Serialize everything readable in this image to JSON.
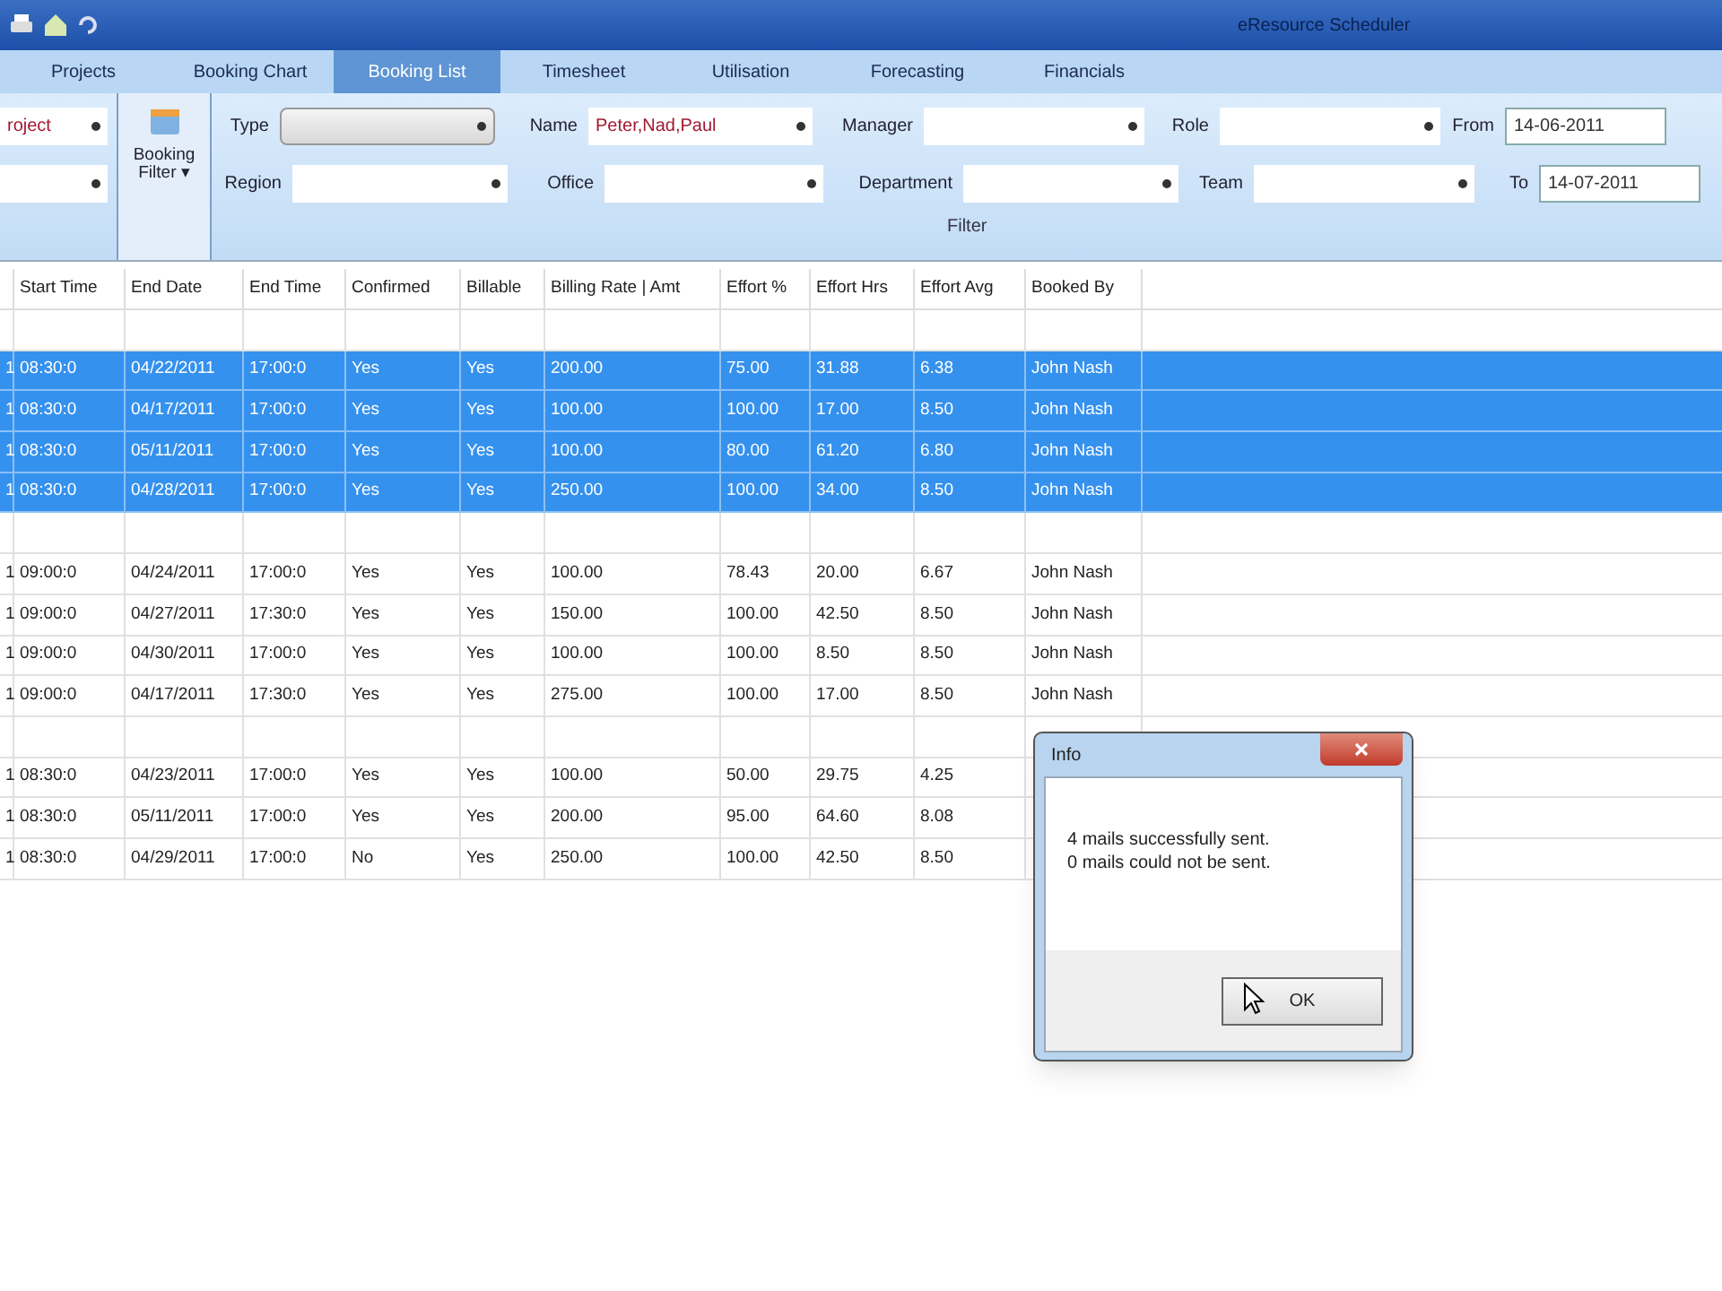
{
  "window": {
    "title": "eResource Scheduler"
  },
  "tabs": [
    {
      "label": "Projects",
      "selected": false
    },
    {
      "label": "Booking Chart",
      "selected": false
    },
    {
      "label": "Booking List",
      "selected": true
    },
    {
      "label": "Timesheet",
      "selected": false
    },
    {
      "label": "Utilisation",
      "selected": false
    },
    {
      "label": "Forecasting",
      "selected": false
    },
    {
      "label": "Financials",
      "selected": false
    }
  ],
  "left_group": {
    "field": {
      "value": "roject"
    }
  },
  "booking_filter_button": {
    "label": "Booking Filter ▾"
  },
  "filter": {
    "group_label": "Filter",
    "rows": [
      [
        {
          "label": "Type",
          "focused": true
        },
        {
          "label": "Name",
          "value": "Peter,Nad,Paul",
          "focused": false
        },
        {
          "label": "Manager",
          "focused": false
        },
        {
          "label": "Role",
          "focused": false
        },
        {
          "label": "From",
          "value": "14-06-2011",
          "kind": "date"
        }
      ],
      [
        {
          "label": "Region",
          "focused": false
        },
        {
          "label": "Office",
          "focused": false
        },
        {
          "label": "Department",
          "focused": false
        },
        {
          "label": "Team",
          "focused": false
        },
        {
          "label": "To",
          "value": "14-07-2011",
          "kind": "date"
        }
      ]
    ]
  },
  "table": {
    "columns": [
      null,
      "Start Time",
      "End Date",
      "End Time",
      "Confirmed",
      "Billable",
      "Billing Rate | Amt",
      "Effort %",
      "Effort Hrs",
      "Effort Avg",
      "Booked By"
    ],
    "rows": [
      {
        "kind": "group",
        "selected": false
      },
      {
        "kind": "data",
        "selected": true,
        "cells": [
          "1",
          "08:30:0",
          "04/22/2011",
          "17:00:0",
          "Yes",
          "Yes",
          "200.00",
          "75.00",
          "31.88",
          "6.38",
          "John Nash"
        ]
      },
      {
        "kind": "data",
        "selected": true,
        "cells": [
          "1",
          "08:30:0",
          "04/17/2011",
          "17:00:0",
          "Yes",
          "Yes",
          "100.00",
          "100.00",
          "17.00",
          "8.50",
          "John Nash"
        ]
      },
      {
        "kind": "data",
        "selected": true,
        "cells": [
          "1",
          "08:30:0",
          "05/11/2011",
          "17:00:0",
          "Yes",
          "Yes",
          "100.00",
          "80.00",
          "61.20",
          "6.80",
          "John Nash"
        ]
      },
      {
        "kind": "data",
        "selected": true,
        "cells": [
          "1",
          "08:30:0",
          "04/28/2011",
          "17:00:0",
          "Yes",
          "Yes",
          "250.00",
          "100.00",
          "34.00",
          "8.50",
          "John Nash"
        ]
      },
      {
        "kind": "group",
        "selected": false
      },
      {
        "kind": "data",
        "selected": false,
        "cells": [
          "1",
          "09:00:0",
          "04/24/2011",
          "17:00:0",
          "Yes",
          "Yes",
          "100.00",
          "78.43",
          "20.00",
          "6.67",
          "John Nash"
        ]
      },
      {
        "kind": "data",
        "selected": false,
        "cells": [
          "1",
          "09:00:0",
          "04/27/2011",
          "17:30:0",
          "Yes",
          "Yes",
          "150.00",
          "100.00",
          "42.50",
          "8.50",
          "John Nash"
        ]
      },
      {
        "kind": "data",
        "selected": false,
        "cells": [
          "1",
          "09:00:0",
          "04/30/2011",
          "17:00:0",
          "Yes",
          "Yes",
          "100.00",
          "100.00",
          "8.50",
          "8.50",
          "John Nash"
        ]
      },
      {
        "kind": "data",
        "selected": false,
        "cells": [
          "1",
          "09:00:0",
          "04/17/2011",
          "17:30:0",
          "Yes",
          "Yes",
          "275.00",
          "100.00",
          "17.00",
          "8.50",
          "John Nash"
        ]
      },
      {
        "kind": "group",
        "selected": false
      },
      {
        "kind": "data",
        "selected": false,
        "cells": [
          "1",
          "08:30:0",
          "04/23/2011",
          "17:00:0",
          "Yes",
          "Yes",
          "100.00",
          "50.00",
          "29.75",
          "4.25",
          null
        ]
      },
      {
        "kind": "data",
        "selected": false,
        "cells": [
          "1",
          "08:30:0",
          "05/11/2011",
          "17:00:0",
          "Yes",
          "Yes",
          "200.00",
          "95.00",
          "64.60",
          "8.08",
          null
        ]
      },
      {
        "kind": "data",
        "selected": false,
        "cells": [
          "1",
          "08:30:0",
          "04/29/2011",
          "17:00:0",
          "No",
          "Yes",
          "250.00",
          "100.00",
          "42.50",
          "8.50",
          null
        ]
      }
    ]
  },
  "dialog": {
    "title": "Info",
    "message_lines": [
      "4 mails successfully sent.",
      "0 mails could not be sent."
    ],
    "button": "OK"
  }
}
